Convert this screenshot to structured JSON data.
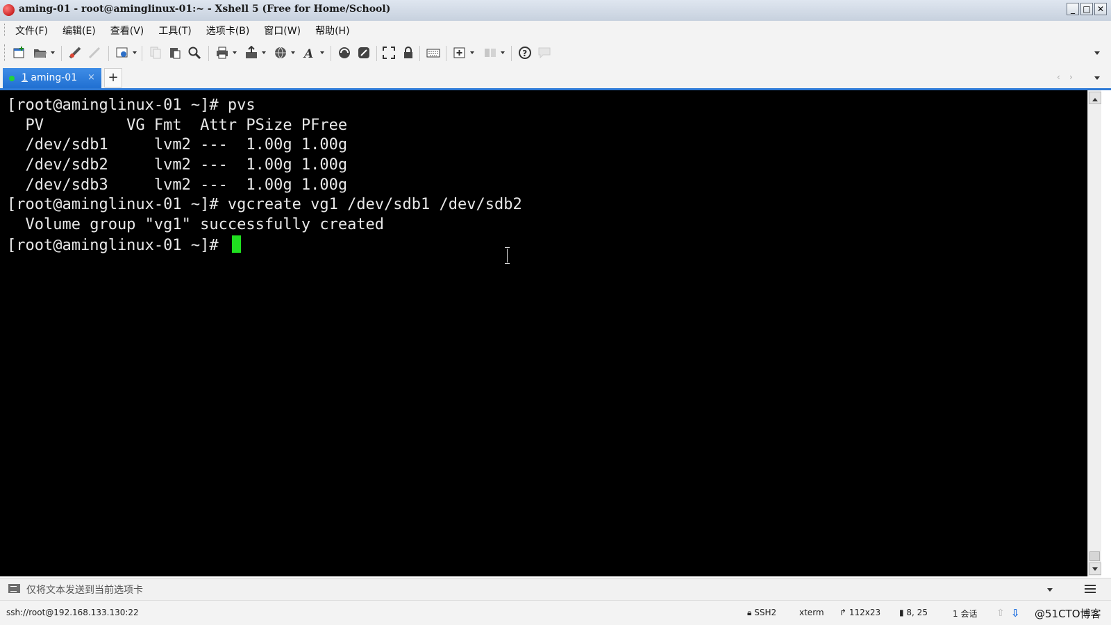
{
  "window": {
    "title": "aming-01 - root@aminglinux-01:~ - Xshell 5 (Free for Home/School)",
    "buttons": {
      "minimize": "_",
      "maximize": "□",
      "close": "✕"
    }
  },
  "menu": {
    "items": [
      "文件(F)",
      "编辑(E)",
      "查看(V)",
      "工具(T)",
      "选项卡(B)",
      "窗口(W)",
      "帮助(H)"
    ]
  },
  "toolbar": {
    "icons": [
      "new-session-icon",
      "open-folder-icon",
      "connect-icon",
      "disconnect-icon",
      "properties-icon",
      "copy-icon",
      "paste-icon",
      "find-icon",
      "print-icon",
      "transfer-icon",
      "globe-icon",
      "font-icon",
      "xftp-icon",
      "xagent-icon",
      "fullscreen-icon",
      "lock-icon",
      "keyboard-icon",
      "new-tab-icon",
      "layout-icon",
      "help-icon",
      "chat-icon"
    ]
  },
  "tabs": {
    "active": {
      "number": "1",
      "label": "aming-01",
      "close": "×"
    },
    "add_label": "+",
    "nav_prev": "‹",
    "nav_next": "›"
  },
  "terminal": {
    "lines": [
      "[root@aminglinux-01 ~]# pvs",
      "  PV         VG Fmt  Attr PSize PFree",
      "  /dev/sdb1     lvm2 ---  1.00g 1.00g",
      "  /dev/sdb2     lvm2 ---  1.00g 1.00g",
      "  /dev/sdb3     lvm2 ---  1.00g 1.00g",
      "[root@aminglinux-01 ~]# vgcreate vg1 /dev/sdb1 /dev/sdb2",
      "  Volume group \"vg1\" successfully created",
      "[root@aminglinux-01 ~]# "
    ],
    "cursor_color": "#20e020",
    "background": "#000000"
  },
  "compose": {
    "text": "仅将文本发送到当前选项卡"
  },
  "status": {
    "connection": "ssh://root@192.168.133.130:22",
    "protocol": "SSH2",
    "terminal_type": "xterm",
    "size": "112x23",
    "cursor_pos": "8, 25",
    "sessions": "1 会话",
    "watermark": "@51CTO博客"
  },
  "colors": {
    "accent": "#2e7ad6",
    "tab_active": "#1f6fd1"
  }
}
